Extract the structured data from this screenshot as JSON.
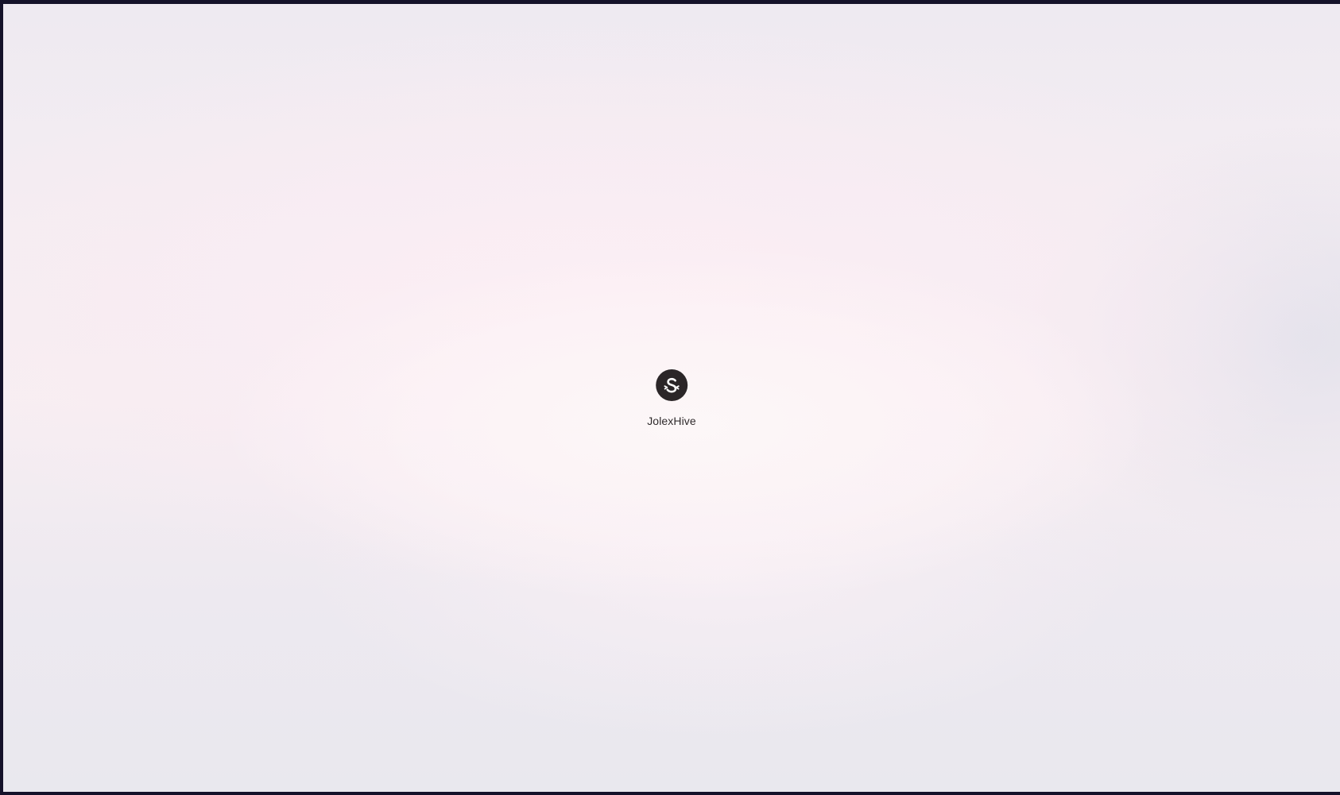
{
  "app": {
    "name": "JolexHive",
    "logo_icon": "jolexhive-logo-icon"
  },
  "colors": {
    "frame": "#15122a",
    "logo_background": "#2b2628",
    "logo_glyph": "#ffffff",
    "text": "#2f2a2c"
  }
}
